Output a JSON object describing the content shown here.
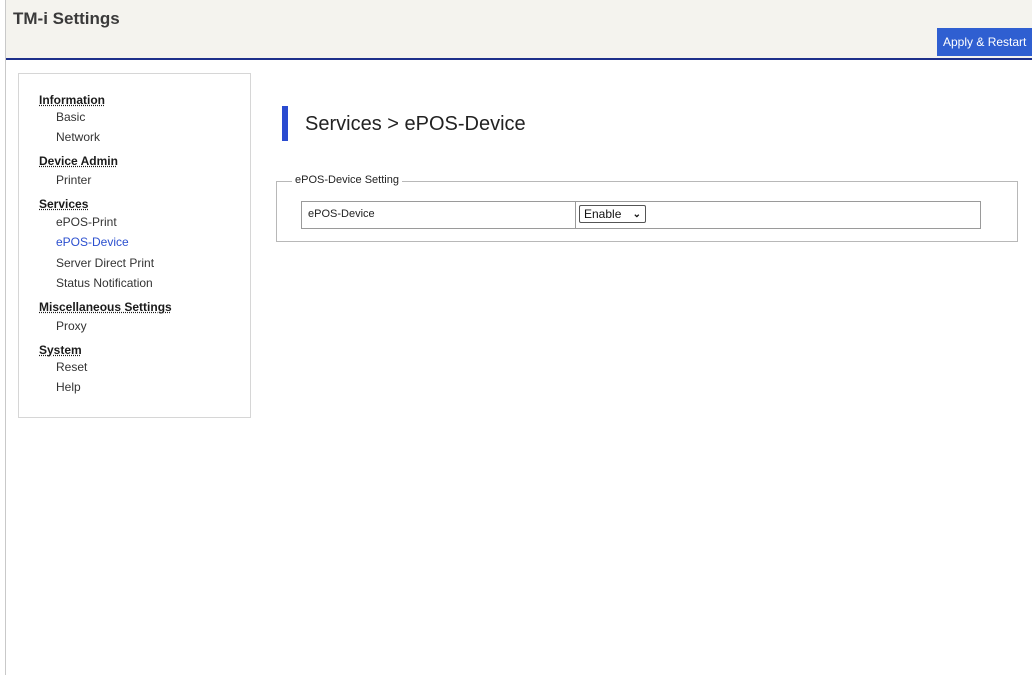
{
  "app": {
    "title": "TM-i Settings"
  },
  "toolbar": {
    "apply_label": "Apply & Restart"
  },
  "sidebar": {
    "groups": [
      {
        "heading": "Information",
        "items": [
          "Basic",
          "Network"
        ]
      },
      {
        "heading": "Device Admin",
        "items": [
          "Printer"
        ]
      },
      {
        "heading": "Services",
        "items": [
          "ePOS-Print",
          "ePOS-Device",
          "Server Direct Print",
          "Status Notification"
        ]
      },
      {
        "heading": "Miscellaneous Settings",
        "items": [
          "Proxy"
        ]
      },
      {
        "heading": "System",
        "items": [
          "Reset",
          "Help"
        ]
      }
    ],
    "active_item": "ePOS-Device"
  },
  "main": {
    "page_title": "Services > ePOS-Device",
    "section_legend": "ePOS-Device Setting",
    "setting_label": "ePOS-Device",
    "setting_value": "Enable"
  },
  "colors": {
    "accent": "#2a4bd0",
    "header_rule": "#1d2f8a",
    "apply_button": "#2f5fd1",
    "active_link": "#2b4fcf"
  }
}
